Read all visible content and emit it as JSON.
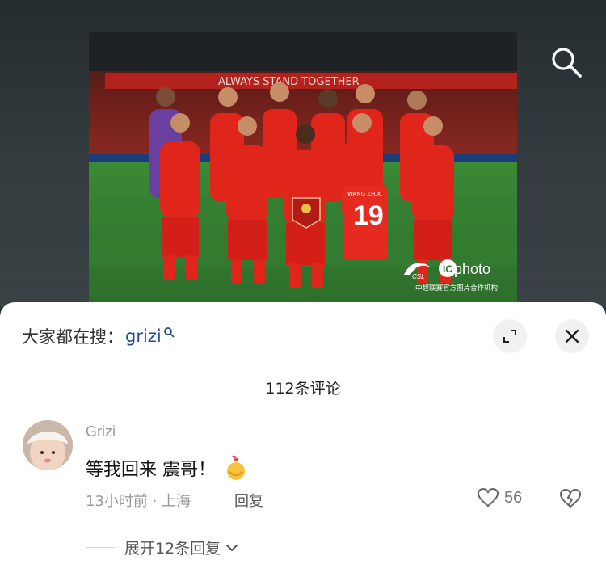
{
  "photo": {
    "banner_text": "ALWAYS STAND TOGETHER",
    "jersey_name": "WANG ZH.X.",
    "jersey_number": "19",
    "watermark": {
      "brand": "photo",
      "league_badge": "CSL",
      "subtitle": "中超联赛官方图片合作机构"
    }
  },
  "header": {
    "search_icon": "search-icon"
  },
  "sheet": {
    "hot_search_label": "大家都在搜：",
    "hot_search_term": "grizi",
    "expand_icon": "expand-icon",
    "close_icon": "close-icon",
    "comment_count_label": "112条评论"
  },
  "comment": {
    "username": "Grizi",
    "text": "等我回来 震哥！",
    "emoji": "hug-emoji",
    "time_location": "13小时前 · 上海",
    "reply_label": "回复",
    "like_count": "56",
    "expand_replies_label": "展开12条回复"
  },
  "colors": {
    "link_blue": "#1f4d8f",
    "jersey_red": "#e0251b",
    "pitch_green": "#2f7a2e"
  }
}
